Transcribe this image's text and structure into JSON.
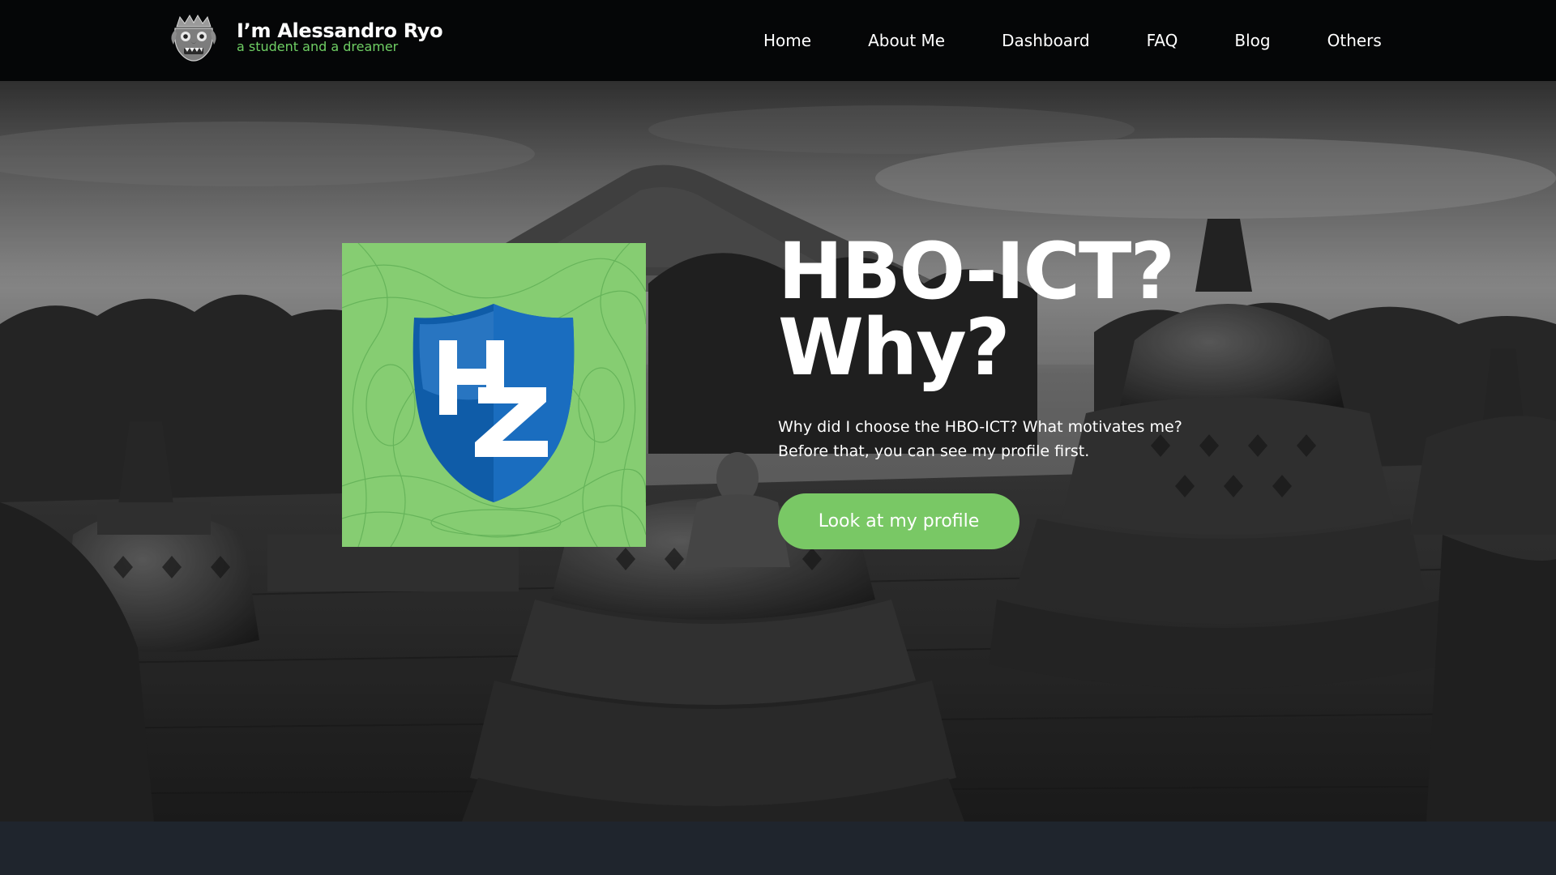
{
  "brand": {
    "name": "I’m Alessandro Ryo",
    "tagline": "a student and a dreamer",
    "logo_icon": "barong-mask-icon"
  },
  "nav": {
    "items": [
      {
        "label": "Home"
      },
      {
        "label": "About Me"
      },
      {
        "label": "Dashboard"
      },
      {
        "label": "FAQ"
      },
      {
        "label": "Blog"
      },
      {
        "label": "Others"
      }
    ]
  },
  "hero": {
    "title_line1": "HBO-ICT?",
    "title_line2": "Why?",
    "description_line1": "Why did I choose the HBO-ICT? What motivates me?",
    "description_line2": "Before that, you can see my profile first.",
    "cta_label": "Look at my profile",
    "logo_card": {
      "logo_text": "HZ",
      "icon": "hz-shield-logo-icon"
    },
    "background_icon": "borobudur-temple-photo"
  },
  "colors": {
    "nav_background": "#050607",
    "accent_green": "#79c865",
    "tagline_green": "#6fcf64",
    "logo_card_green": "#86cd72",
    "shield_blue": "#1565b8",
    "footer_strip": "#1f252d"
  }
}
